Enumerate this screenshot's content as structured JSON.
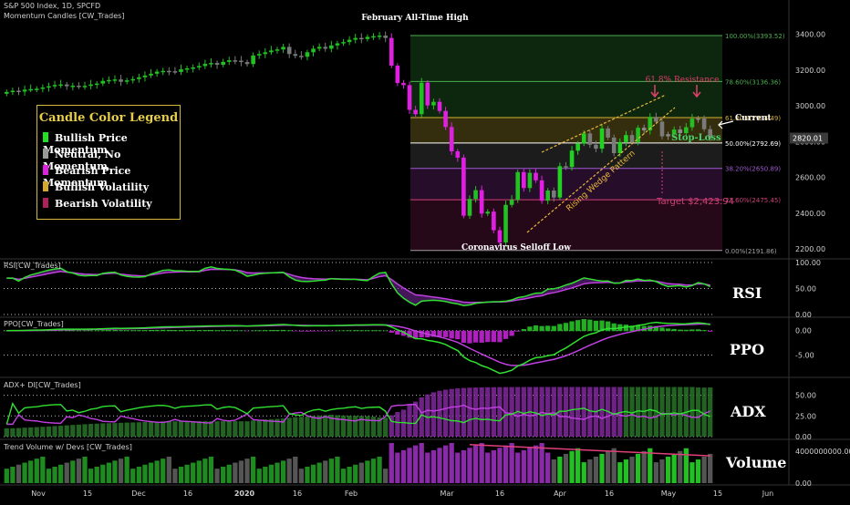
{
  "chart_data": {
    "type": "candlestick",
    "header": {
      "line1": "S&P 500 Index, 1D, SPCFD",
      "line2": "Momentum Candles [CW_Trades]"
    },
    "price_axis": {
      "ticks": [
        "3400.00",
        "3200.00",
        "3000.00",
        "2800.00",
        "2600.00",
        "2400.00",
        "2200.00"
      ],
      "ylim": [
        2150,
        3480
      ]
    },
    "last_price": "2820.01",
    "x_axis_ticks": [
      "Nov",
      "15",
      "Dec",
      "16",
      "2020",
      "16",
      "Feb",
      "Mar",
      "16",
      "Apr",
      "16",
      "May",
      "15",
      "Jun"
    ],
    "annotations": {
      "top_label": "February All-Time High",
      "bottom_label": "Coronavirus Selloff Low",
      "resistance": "61.8% Resistance",
      "current": "Current",
      "stop_loss": "Stop-Loss",
      "target": "Target $2,423.94",
      "pattern": "Rising Wedge Pattern"
    },
    "fib_levels": [
      {
        "label": "100.00%(3393.52)",
        "price": 3393.52,
        "color": "#4caf50"
      },
      {
        "label": "78.60%(3136.36)",
        "price": 3136.36,
        "color": "#4caf50"
      },
      {
        "label": "61.80%(2934.49)",
        "price": 2934.49,
        "color": "#d4b030"
      },
      {
        "label": "50.00%(2792.69)",
        "price": 2792.69,
        "color": "#ffffff"
      },
      {
        "label": "38.20%(2650.89)",
        "price": 2650.89,
        "color": "#a05ad0"
      },
      {
        "label": "23.60%(2475.45)",
        "price": 2475.45,
        "color": "#d0407a"
      },
      {
        "label": "0.00%(2191.86)",
        "price": 2191.86,
        "color": "#a0a0a0"
      }
    ],
    "legend": {
      "title": "Candle Color Legend",
      "items": [
        {
          "label": "Bullish Price Momentum",
          "color": "#22e022"
        },
        {
          "label": "Neutral, No Momentum",
          "color": "#9a9a9a"
        },
        {
          "label": "Bearish Price Momentum",
          "color": "#e020e0"
        },
        {
          "label": "Bullish Volatility",
          "color": "#d4a82a"
        },
        {
          "label": "Bearish Volatility",
          "color": "#b0205a"
        }
      ]
    },
    "close_series": [
      3078,
      3085,
      3080,
      3091,
      3094,
      3096,
      3103,
      3110,
      3117,
      3120,
      3110,
      3113,
      3108,
      3112,
      3120,
      3125,
      3140,
      3145,
      3148,
      3135,
      3143,
      3150,
      3160,
      3170,
      3180,
      3192,
      3196,
      3194,
      3190,
      3205,
      3210,
      3215,
      3223,
      3235,
      3240,
      3230,
      3246,
      3255,
      3253,
      3245,
      3234,
      3282,
      3290,
      3300,
      3310,
      3316,
      3330,
      3290,
      3280,
      3275,
      3300,
      3320,
      3330,
      3320,
      3338,
      3350,
      3357,
      3370,
      3380,
      3374,
      3386,
      3390,
      3393,
      3380,
      3225,
      3128,
      3116,
      2978,
      2954,
      3130,
      3003,
      3023,
      2972,
      2882,
      2746,
      2711,
      2386,
      2480,
      2529,
      2398,
      2409,
      2305,
      2237,
      2447,
      2475,
      2630,
      2541,
      2626,
      2584,
      2470,
      2527,
      2488,
      2663,
      2659,
      2750,
      2790,
      2846,
      2783,
      2761,
      2874,
      2823,
      2736,
      2798,
      2837,
      2797,
      2878,
      2863,
      2939,
      2912,
      2830,
      2842,
      2868,
      2848,
      2881,
      2929,
      2930,
      2870,
      2820
    ],
    "volatility_tags": {
      "bearish_index_range": [
        64,
        90
      ]
    },
    "indicators": [
      {
        "name": "RSI[CW_Trades]",
        "label": "RSI",
        "ticks": [
          "100.00",
          "50.00",
          "0.00"
        ],
        "ylim": [
          0,
          100
        ]
      },
      {
        "name": "PPO[CW_Trades]",
        "label": "PPO",
        "ticks": [
          "0.00",
          "-5.00"
        ],
        "ylim": [
          -9,
          2
        ]
      },
      {
        "name": "ADX+ DI[CW_Trades]",
        "label": "ADX",
        "ticks": [
          "50.00",
          "25.00",
          "0.00"
        ],
        "ylim": [
          0,
          65
        ]
      },
      {
        "name": "Trend Volume w/ Devs [CW_Trades]",
        "label": "Volume",
        "ticks": [
          "4000000000.00",
          "0.00"
        ],
        "ylim": [
          0,
          5000000000
        ]
      }
    ]
  }
}
